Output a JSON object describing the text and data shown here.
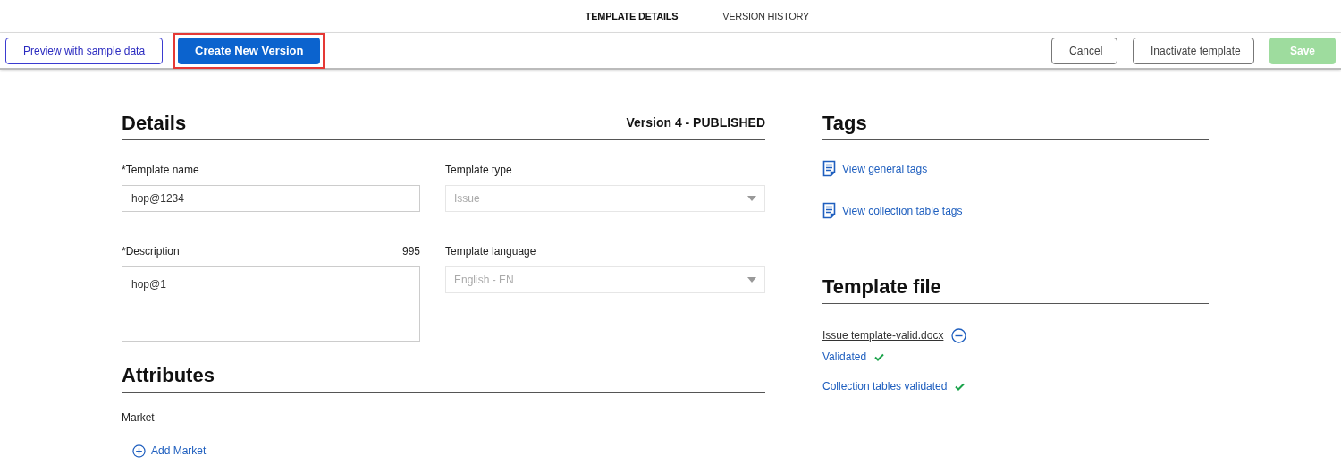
{
  "tabs": [
    {
      "label": "TEMPLATE DETAILS",
      "selected": true
    },
    {
      "label": "VERSION HISTORY",
      "selected": false
    }
  ],
  "toolbar": {
    "left": [
      {
        "label": "Preview with sample data",
        "kind": "outline",
        "disabled": false,
        "highlighted": false
      },
      {
        "label": "Create New Version",
        "kind": "primary",
        "disabled": false,
        "highlighted": true
      }
    ],
    "right": [
      {
        "label": "Cancel",
        "kind": "secondary",
        "disabled": false,
        "highlighted": false
      },
      {
        "label": "Inactivate template",
        "kind": "secondary",
        "disabled": false,
        "highlighted": false
      },
      {
        "label": "Save",
        "kind": "success",
        "disabled": true,
        "highlighted": false
      }
    ]
  },
  "details": {
    "title": "Details",
    "version": "Version 4 - PUBLISHED",
    "template_name": {
      "label": "*Template name",
      "value": "hop@1234"
    },
    "description": {
      "label": "*Description",
      "counter": "995",
      "value": "hop@1"
    },
    "template_type": {
      "label": "Template type",
      "value": "Issue",
      "disabled": true
    },
    "template_language": {
      "label": "Template language",
      "value": "English - EN",
      "disabled": true
    }
  },
  "attributes": {
    "title": "Attributes",
    "market_label": "Market",
    "add_link": "Add Market"
  },
  "tags": {
    "title": "Tags",
    "links": [
      "View general tags",
      "View collection table tags"
    ]
  },
  "template_file": {
    "title": "Template file",
    "file_name": "Issue template-valid.docx",
    "statuses": [
      {
        "label": "Validated",
        "ok": true
      },
      {
        "label": "Collection tables validated",
        "ok": true
      }
    ]
  }
}
